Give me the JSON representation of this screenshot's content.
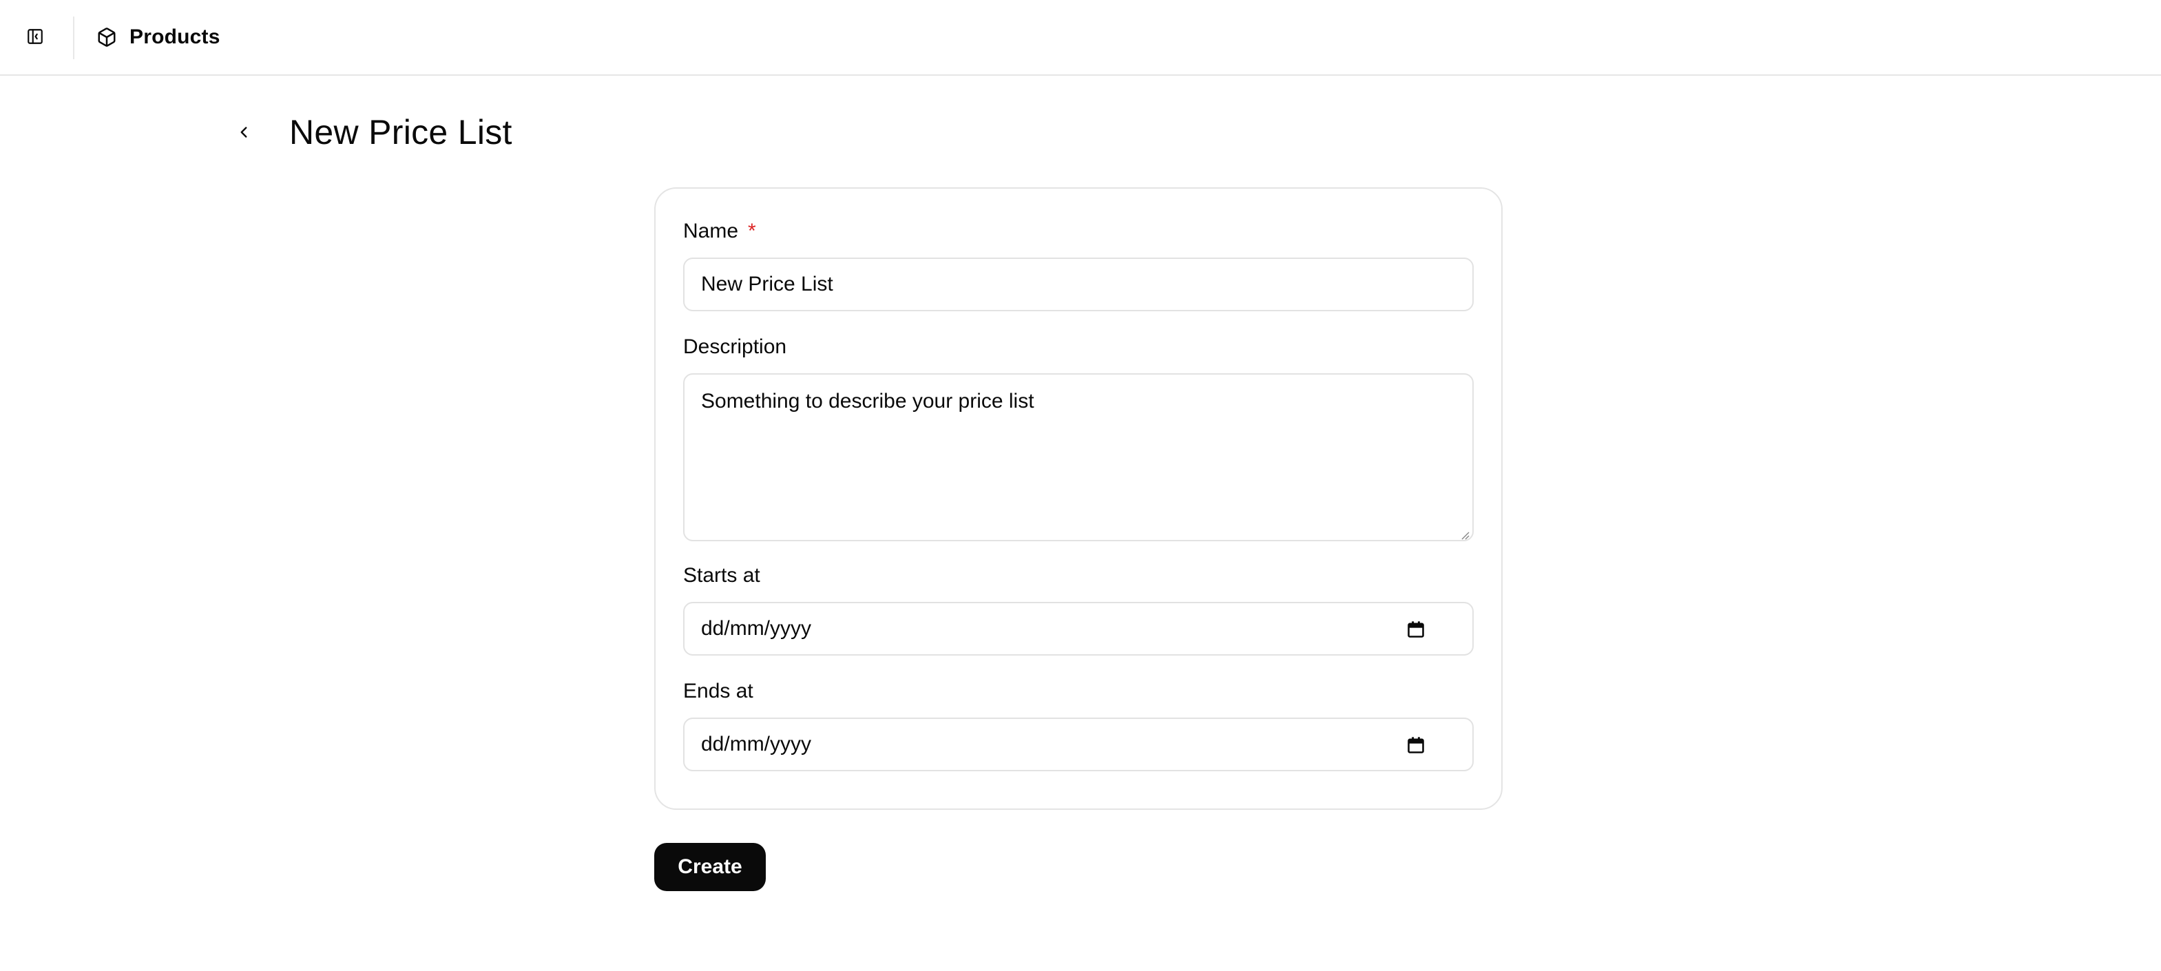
{
  "topbar": {
    "sidebar_toggle_icon": "panel-left-icon",
    "breadcrumb": {
      "icon": "package-icon",
      "label": "Products"
    }
  },
  "page": {
    "back_icon": "chevron-left-icon",
    "title": "New Price List"
  },
  "form": {
    "name": {
      "label": "Name",
      "required_mark": "*",
      "value": "New Price List"
    },
    "description": {
      "label": "Description",
      "value": "Something to describe your price list"
    },
    "starts_at": {
      "label": "Starts at",
      "placeholder": "dd/mm/yyyy",
      "icon": "calendar-icon"
    },
    "ends_at": {
      "label": "Ends at",
      "placeholder": "dd/mm/yyyy",
      "icon": "calendar-icon"
    },
    "submit_label": "Create"
  },
  "colors": {
    "required": "#dc2626",
    "primary_button": "#0a0a0a",
    "border": "#e2e2e2"
  }
}
